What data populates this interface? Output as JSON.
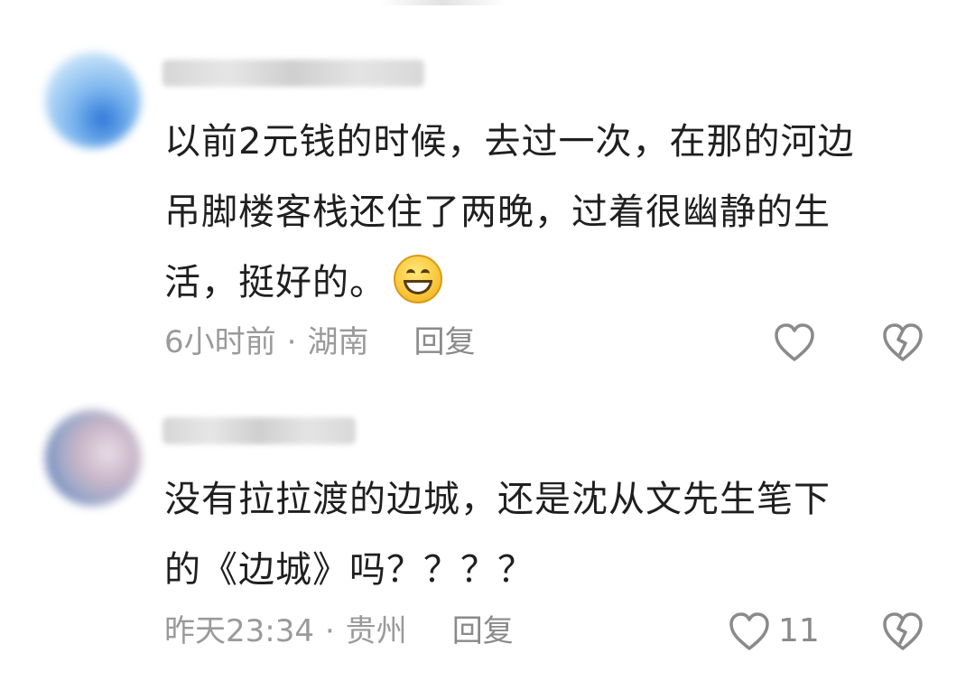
{
  "comments": [
    {
      "text_lines": [
        "以前2元钱的时候，去过一次，在那的河边",
        "吊脚楼客栈还住了两晚，过着很幽静的生",
        "活，挺好的。"
      ],
      "emoji": "grinning-face",
      "time": "6小时前",
      "separator": "·",
      "location": "湖南",
      "reply_label": "回复",
      "likes": ""
    },
    {
      "text_lines": [
        "没有拉拉渡的边城，还是沈从文先生笔下",
        "的《边城》吗？？？？"
      ],
      "time": "昨天23:34",
      "separator": "·",
      "location": "贵州",
      "reply_label": "回复",
      "likes": "11"
    }
  ],
  "icons": {
    "like": "heart-outline-icon",
    "dislike": "broken-heart-icon"
  },
  "colors": {
    "text": "#1f1f1f",
    "meta": "#9a9a9a",
    "icon": "#8a8a8a"
  }
}
